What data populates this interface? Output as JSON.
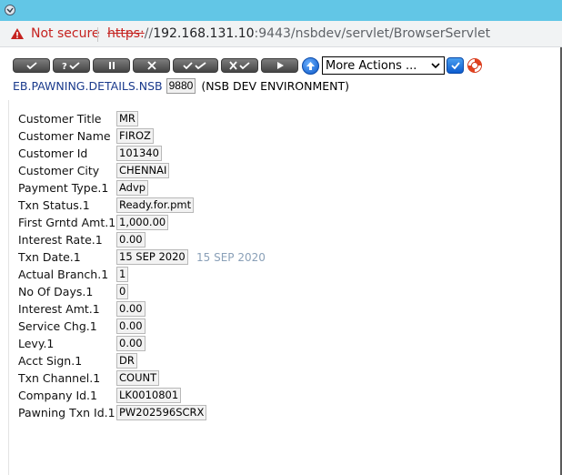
{
  "browser": {
    "not_secure": "Not secure",
    "url_scheme": "https:",
    "url_slashes": "//",
    "url_host": "192.168.131.10",
    "url_path": ":9443/nsbdev/servlet/BrowserServlet"
  },
  "toolbar": {
    "buttons": [
      "✓",
      "?✓",
      "||",
      "✕",
      "✓✓",
      "✕✓",
      "▶"
    ],
    "actions_select": "More Actions ...",
    "icons": [
      "commit-icon",
      "validate-icon",
      "hold-icon",
      "delete-icon",
      "authorise-icon",
      "reverse-icon",
      "next-icon",
      "up-arrow-icon",
      "go-icon",
      "help-lifebuoy-icon"
    ]
  },
  "header": {
    "application": "EB.PAWNING.DETAILS.NSB",
    "record_id": "9880",
    "environment": "(NSB DEV ENVIRONMENT)"
  },
  "fields": [
    {
      "label": "Customer Title",
      "value": "MR"
    },
    {
      "label": "Customer Name",
      "value": "FIROZ"
    },
    {
      "label": "Customer Id",
      "value": "101340"
    },
    {
      "label": "Customer City",
      "value": "CHENNAI"
    },
    {
      "label": "Payment Type.1",
      "value": "Advp"
    },
    {
      "label": "Txn Status.1",
      "value": "Ready.for.pmt"
    },
    {
      "label": "First Grntd Amt.1",
      "value": "1,000.00"
    },
    {
      "label": "Interest Rate.1",
      "value": "0.00"
    },
    {
      "label": "Txn Date.1",
      "value": "15 SEP 2020",
      "enrichment": "15 SEP 2020"
    },
    {
      "label": "Actual Branch.1",
      "value": "1"
    },
    {
      "label": "No Of Days.1",
      "value": "0"
    },
    {
      "label": "Interest Amt.1",
      "value": "0.00"
    },
    {
      "label": "Service Chg.1",
      "value": "0.00"
    },
    {
      "label": "Levy.1",
      "value": "0.00"
    },
    {
      "label": "Acct Sign.1",
      "value": "DR"
    },
    {
      "label": "Txn Channel.1",
      "value": "COUNT"
    },
    {
      "label": "Company Id.1",
      "value": "LK0010801"
    },
    {
      "label": "Pawning Txn Id.1",
      "value": "PW202596SCRX"
    }
  ],
  "colors": {
    "titlebar": "#62c6e6",
    "not_secure": "#c5221f",
    "app_name": "#1a3a8c",
    "enrichment": "#8aa0b8"
  }
}
